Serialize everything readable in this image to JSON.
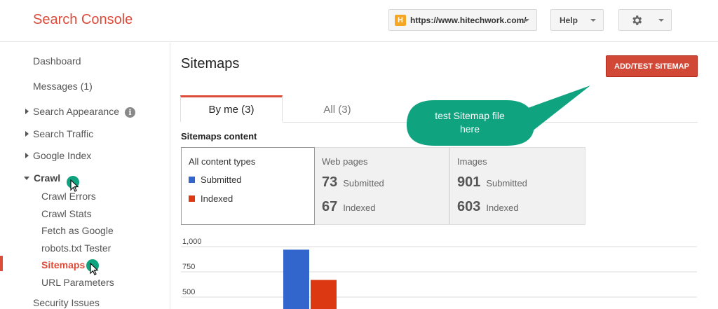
{
  "header": {
    "brand": "Search Console",
    "site_url": "https://www.hitechwork.com/",
    "site_favicon": "H",
    "help_label": "Help"
  },
  "sidebar": {
    "items": [
      {
        "label": "Dashboard"
      },
      {
        "label": "Messages (1)"
      },
      {
        "label": "Search Appearance"
      },
      {
        "label": "Search Traffic"
      },
      {
        "label": "Google Index"
      },
      {
        "label": "Crawl"
      },
      {
        "label": "Security Issues"
      }
    ],
    "crawl_children": [
      {
        "label": "Crawl Errors"
      },
      {
        "label": "Crawl Stats"
      },
      {
        "label": "Fetch as Google"
      },
      {
        "label": "robots.txt Tester"
      },
      {
        "label": "Sitemaps"
      },
      {
        "label": "URL Parameters"
      }
    ],
    "info_glyph": "i"
  },
  "main": {
    "title": "Sitemaps",
    "add_button": "ADD/TEST SITEMAP",
    "tabs": [
      {
        "label": "By me (3)"
      },
      {
        "label": "All (3)"
      }
    ],
    "content_label": "Sitemaps content",
    "panels": {
      "all": {
        "heading": "All content types",
        "legend": [
          {
            "label": "Submitted",
            "color": "#3366cc"
          },
          {
            "label": "Indexed",
            "color": "#dc3912"
          }
        ]
      },
      "web": {
        "heading": "Web pages",
        "submitted_num": "73",
        "submitted_lbl": "Submitted",
        "indexed_num": "67",
        "indexed_lbl": "Indexed"
      },
      "images": {
        "heading": "Images",
        "submitted_num": "901",
        "submitted_lbl": "Submitted",
        "indexed_num": "603",
        "indexed_lbl": "Indexed"
      }
    }
  },
  "callout": {
    "line1": "test Sitemap file",
    "line2": "here",
    "color": "#0fa37f"
  },
  "chart_data": {
    "type": "bar",
    "categories": [
      ""
    ],
    "series": [
      {
        "name": "Submitted",
        "values": [
          970
        ],
        "color": "#3366cc"
      },
      {
        "name": "Indexed",
        "values": [
          670
        ],
        "color": "#dc3912"
      }
    ],
    "yticks": [
      "1,000",
      "750",
      "500"
    ],
    "ylim": [
      0,
      1000
    ]
  },
  "colors": {
    "accent": "#dd4b39",
    "pointer": "#0fa37f"
  }
}
